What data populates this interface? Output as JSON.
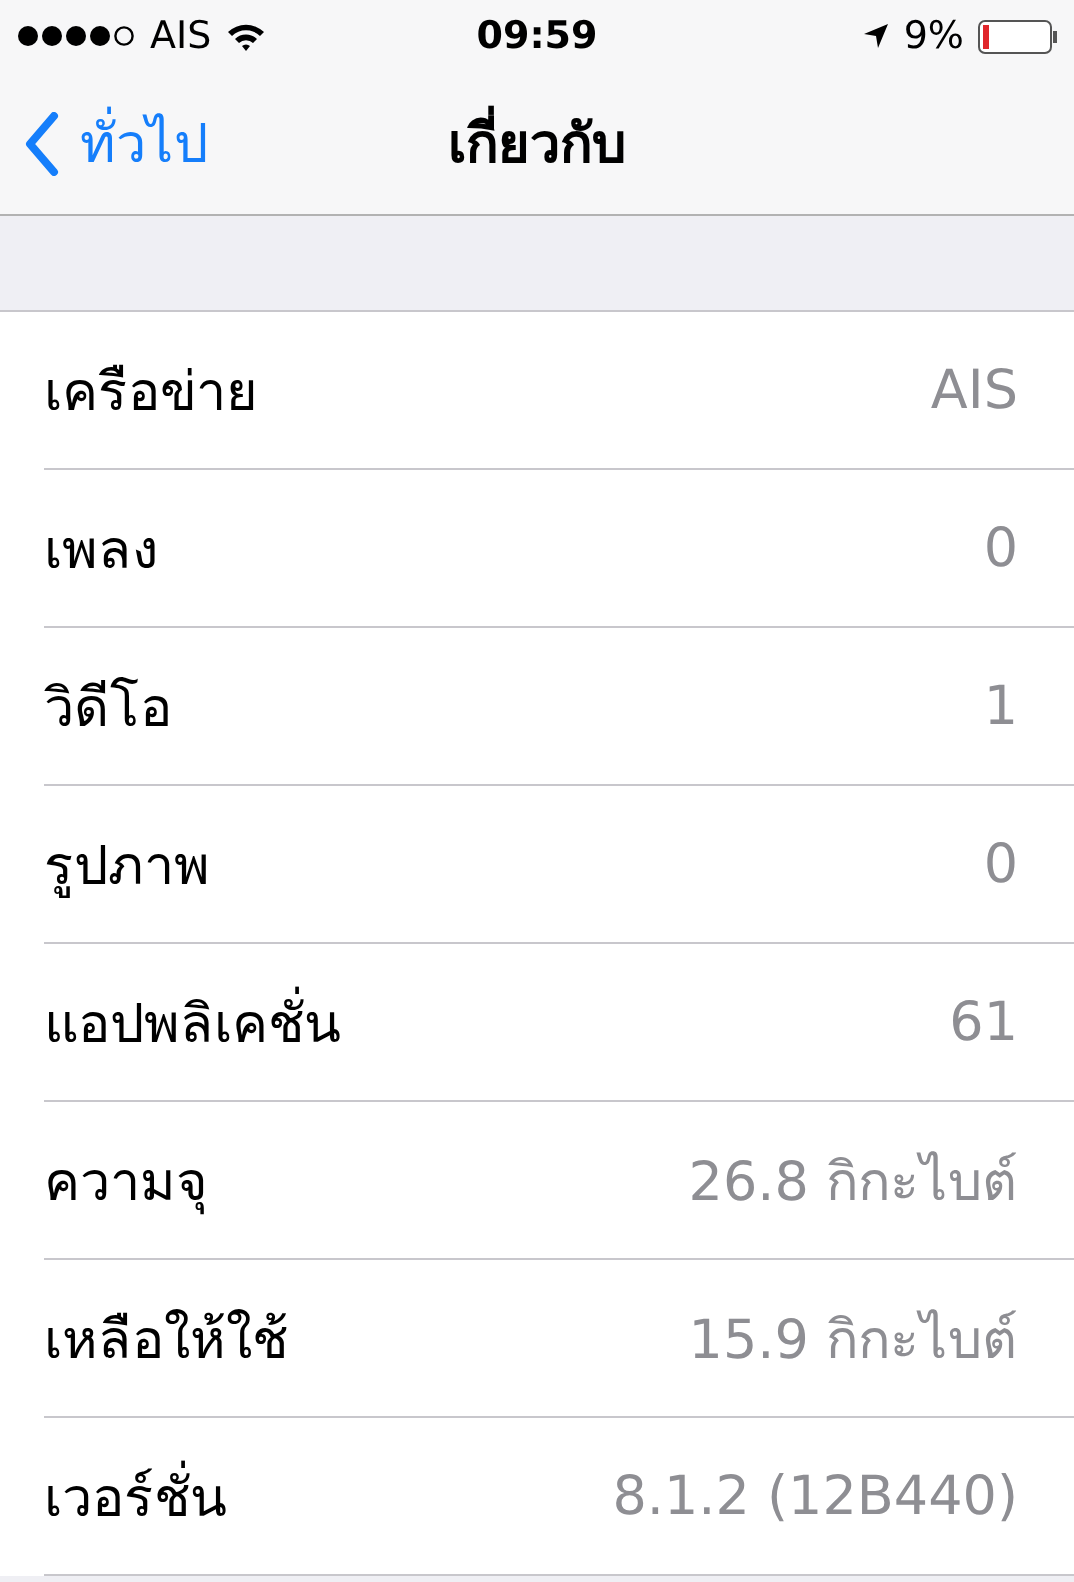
{
  "status_bar": {
    "carrier": "AIS",
    "time": "09:59",
    "battery": "9%"
  },
  "nav": {
    "back": "ทั่วไป",
    "title": "เกี่ยวกับ"
  },
  "rows": [
    {
      "label": "เครือข่าย",
      "value": "AIS"
    },
    {
      "label": "เพลง",
      "value": "0"
    },
    {
      "label": "วิดีโอ",
      "value": "1"
    },
    {
      "label": "รูปภาพ",
      "value": "0"
    },
    {
      "label": "แอปพลิเคชั่น",
      "value": "61"
    },
    {
      "label": "ความจุ",
      "value": "26.8 กิกะไบต์"
    },
    {
      "label": "เหลือให้ใช้",
      "value": "15.9 กิกะไบต์"
    },
    {
      "label": "เวอร์ชั่น",
      "value": "8.1.2 (12B440)"
    }
  ]
}
